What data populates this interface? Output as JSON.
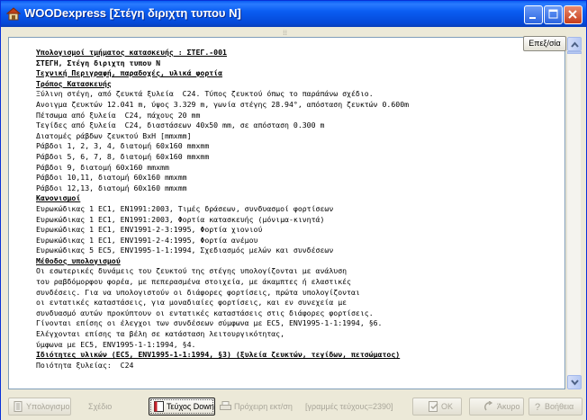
{
  "window": {
    "title": "WOODexpress   [Στέγη διριχτη τυπου Ν]"
  },
  "colors": {
    "titlebar": "#0a5df2",
    "close_button": "#c63d1c",
    "document_background": "#ffffff",
    "disabled_text": "#a9a69a"
  },
  "document": {
    "top_button_label": "Επεξ/σία",
    "lines": [
      {
        "text": "Υπολογισμοί τμήματος κατασκευής : ΣΤΕΓ.-001",
        "style": "head"
      },
      {
        "text": "ΣΤΕΓΗ, Στέγη διριχτη τυπου Ν",
        "style": "bold"
      },
      {
        "text": "Τεχνική Περιγραφή, παραδοχές, υλικά φορτία",
        "style": "head"
      },
      {
        "text": "Τρόπος Κατασκευής",
        "style": "head"
      },
      {
        "text": "Ξύλινη στέγη, από ζευκτά ξυλεία  C24. Τύπος ζευκτού όπως το παράπάνω σχέδιο.",
        "style": ""
      },
      {
        "text": "Ανοιγμα ζευκτών 12.041 m, ύψος 3.329 m, γωνία στέγης 28.94°, απόσταση ζευκτών 0.600m",
        "style": ""
      },
      {
        "text": "Πέτσωμα από ξυλεία  C24, πάχους 20 mm",
        "style": ""
      },
      {
        "text": "Τεγίδες από ξυλεία  C24, διαστάσεων 40x50 mm, σε απόσταση 0.300 m",
        "style": ""
      },
      {
        "text": "Διατομές ράβδων ζευκτού BxH [mmxmm]",
        "style": ""
      },
      {
        "text": "Ράβδοι 1, 2, 3, 4, διατομή 60x160 mmxmm",
        "style": ""
      },
      {
        "text": "Ράβδοι 5, 6, 7, 8, διατομή 60x160 mmxmm",
        "style": ""
      },
      {
        "text": "Ράβδοι 9, διατομή 60x160 mmxmm",
        "style": ""
      },
      {
        "text": "Ράβδοι 10,11, διατομή 60x160 mmxmm",
        "style": ""
      },
      {
        "text": "Ράβδοι 12,13, διατομή 60x160 mmxmm",
        "style": ""
      },
      {
        "text": "Κανονισμοί",
        "style": "head"
      },
      {
        "text": "Ευρωκώδικας 1 EC1, EN1991:2003, Τιμές δράσεων, συνδυασμοί φορτίσεων",
        "style": ""
      },
      {
        "text": "Ευρωκώδικας 1 EC1, EN1991:2003, Φορτία κατασκευής (μόνιμα-κινητά)",
        "style": ""
      },
      {
        "text": "Ευρωκώδικας 1 EC1, ENV1991-2-3:1995, Φορτία χιονιού",
        "style": ""
      },
      {
        "text": "Ευρωκώδικας 1 EC1, ENV1991-2-4:1995, Φορτία ανέμου",
        "style": ""
      },
      {
        "text": "Ευρωκώδικας 5 EC5, ENV1995-1-1:1994, Σχεδιασμός μελών και συνδέσεων",
        "style": ""
      },
      {
        "text": "Μέθοδος υπολογισμού",
        "style": "head"
      },
      {
        "text": "Οι εσωτερικές δυνάμεις του ζευκτού της στέγης υπολογίζονται με ανάλυση",
        "style": ""
      },
      {
        "text": "του ραβδόμορφου φορέα, με πεπερασμένα στοιχεία, με άκαμπτες ή ελαστικές",
        "style": ""
      },
      {
        "text": "συνδέσεις. Για να υπολογιστούν οι διάφορες φορτίσεις, πρώτα υπολογίζονται",
        "style": ""
      },
      {
        "text": "οι εντατικές καταστάσεις, για μοναδιαίες φορτίσεις, και εν συνεχεία με",
        "style": ""
      },
      {
        "text": "συνδυασμό αυτών προκύπτουν οι εντατικές καταστάσεις στις διάφορες φορτίσεις.",
        "style": ""
      },
      {
        "text": "Γίνονται επίσης οι έλεγχοι των συνδέσεων σύμφωνα με EC5, ENV1995-1-1:1994, §6.",
        "style": ""
      },
      {
        "text": "Ελέγχονται επίσης τα βέλη σε κατάσταση λειτουργικότητας,",
        "style": ""
      },
      {
        "text": "ύμφωνα με EC5, ENV1995-1-1:1994, §4.",
        "style": ""
      },
      {
        "text": "Ιδιότητες υλικών (EC5, ENV1995-1-1:1994, §3) (ξυλεία ζευκτών, τεγίδων, πετσώματος)",
        "style": "head"
      },
      {
        "text": "Ποιότητα ξυλείας:  C24",
        "style": ""
      }
    ]
  },
  "toolbar": {
    "calcs_label": "Υπολογισμοί",
    "sketch_label": "Σχέδιο",
    "teuxos_label": "Τεύχος Down",
    "print_label": "Πρόχειρη εκτ/ση",
    "lines_info": "[γραμμές τεύχους=2390]",
    "ok_label": "OK",
    "cancel_label": "Άκυρο",
    "help_label": "Βοήθεια"
  }
}
